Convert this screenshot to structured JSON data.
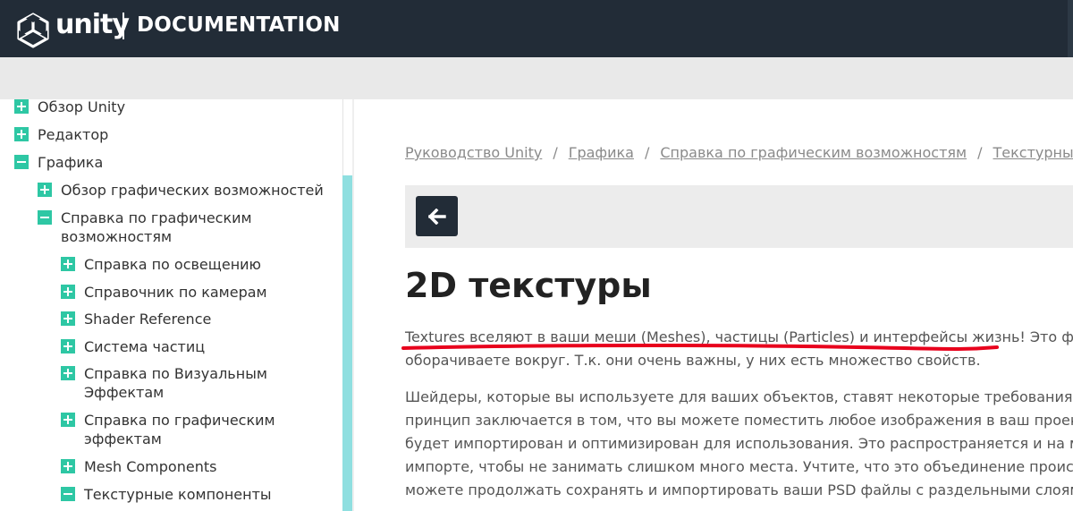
{
  "header": {
    "logo_text": "unity",
    "section_text": "DOCUMENTATION",
    "logo_icon": "unity-cube-icon"
  },
  "sidebar": {
    "items": [
      {
        "label": "Обзор Unity",
        "state": "plus",
        "level": 0
      },
      {
        "label": "Редактор",
        "state": "plus",
        "level": 0
      },
      {
        "label": "Графика",
        "state": "minus",
        "level": 0
      },
      {
        "label": "Обзор графических возможностей",
        "state": "plus",
        "level": 1
      },
      {
        "label": "Справка по графическим",
        "label2": "возможностям",
        "state": "minus",
        "level": 1
      },
      {
        "label": "Справка по освещению",
        "state": "plus",
        "level": 2
      },
      {
        "label": "Справочник по камерам",
        "state": "plus",
        "level": 2
      },
      {
        "label": "Shader Reference",
        "state": "plus",
        "level": 2
      },
      {
        "label": "Система частиц",
        "state": "plus",
        "level": 2
      },
      {
        "label": "Справка по Визуальным",
        "label2": "Эффектам",
        "state": "plus",
        "level": 2
      },
      {
        "label": "Справка по графическим",
        "label2": "эффектам",
        "state": "plus",
        "level": 2
      },
      {
        "label": "Mesh Components",
        "state": "plus",
        "level": 2
      },
      {
        "label": "Текстурные компоненты",
        "state": "minus",
        "level": 2
      }
    ]
  },
  "breadcrumb": {
    "items": [
      "Руководство Unity",
      "Графика",
      "Справка по графическим возможностям",
      "Текстурные компоненты"
    ],
    "separator": "/"
  },
  "toolbar": {
    "back_icon": "arrow-left-icon"
  },
  "page": {
    "title": "2D текстуры",
    "paragraphs": [
      "Textures вселяют в ваши меши (Meshes), частицы (Particles) и интерфейсы жизнь! Это файлы изображений или видео, которые вы",
      "оборачиваете вокруг. Т.к. они очень важны, у них есть множество свойств.",
      "Шейдеры, которые вы используете для ваших объектов, ставят некоторые требования, для каких текстур вам нужны. Но основной",
      "принцип заключается в том, что вы можете поместить любое изображения в ваш проект. Если оно соответствует требованиям, оно",
      "будет импортирован и оптимизирован для использования. Это распространяется и на многослойные файлы PSD — они сводятся при",
      "импорте, чтобы не занимать слишком много места. Учтите, что это объединение происходит внутри Unity и не является опциональным, так что вы",
      "можете продолжать сохранять и импортировать ваши PSD файлы с раздельными слоями. Снова и снова."
    ]
  },
  "colors": {
    "header_bg": "#222c37",
    "accent": "#2ec7a4",
    "scrollbar": "#8fdfe0",
    "annotation": "#e8001c"
  }
}
